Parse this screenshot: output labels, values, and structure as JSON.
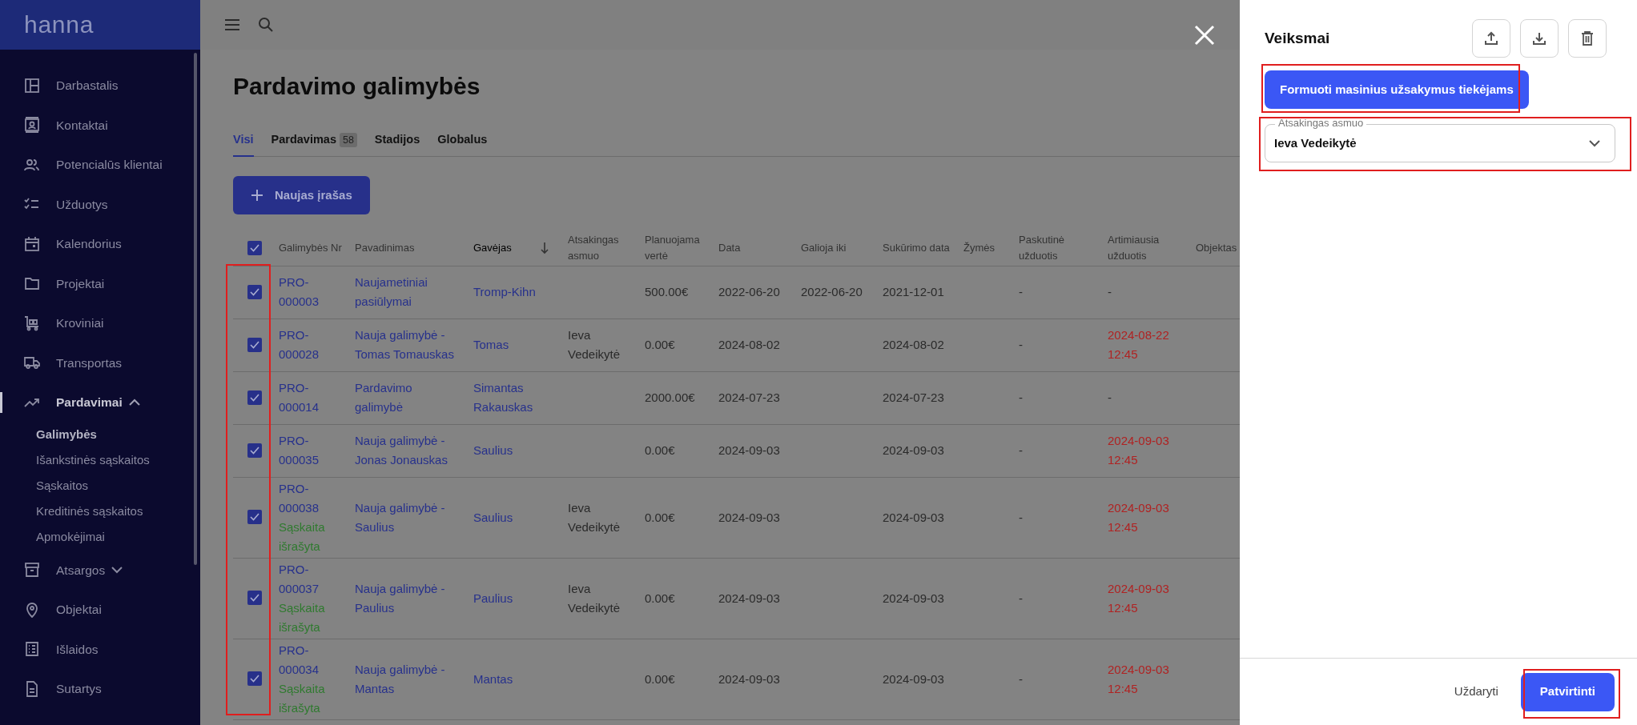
{
  "sidebar": {
    "logo": "hanna",
    "items": [
      {
        "label": "Darbastalis",
        "selected": false
      },
      {
        "label": "Kontaktai",
        "selected": false
      },
      {
        "label": "Potencialūs klientai",
        "selected": false
      },
      {
        "label": "Užduotys",
        "selected": false
      },
      {
        "label": "Kalendorius",
        "selected": false
      },
      {
        "label": "Projektai",
        "selected": false
      },
      {
        "label": "Kroviniai",
        "selected": false
      },
      {
        "label": "Transportas",
        "selected": false
      },
      {
        "label": "Pardavimai",
        "selected": true,
        "expanded": true,
        "children": [
          {
            "label": "Galimybės",
            "selected": true
          },
          {
            "label": "Išankstinės sąskaitos",
            "selected": false
          },
          {
            "label": "Sąskaitos",
            "selected": false
          },
          {
            "label": "Kreditinės sąskaitos",
            "selected": false
          },
          {
            "label": "Apmokėjimai",
            "selected": false
          }
        ]
      },
      {
        "label": "Atsargos",
        "selected": false,
        "expanded": false
      },
      {
        "label": "Objektai",
        "selected": false
      },
      {
        "label": "Išlaidos",
        "selected": false
      },
      {
        "label": "Sutartys",
        "selected": false
      }
    ]
  },
  "page": {
    "title": "Pardavimo galimybės",
    "tabs": [
      {
        "label": "Visi",
        "selected": true
      },
      {
        "label": "Pardavimas",
        "badge": "58",
        "selected": false
      },
      {
        "label": "Stadijos",
        "selected": false
      },
      {
        "label": "Globalus",
        "selected": false
      }
    ],
    "new_button": "Naujas įrašas"
  },
  "table": {
    "all_checked": true,
    "columns": [
      {
        "label": "Galimybės Nr",
        "sorted": false
      },
      {
        "label": "Pavadinimas",
        "sorted": false
      },
      {
        "label": "Gavėjas",
        "sorted": true
      },
      {
        "label": "Atsakingas asmuo",
        "sorted": false
      },
      {
        "label": "Planuojama vertė",
        "sorted": false
      },
      {
        "label": "Data",
        "sorted": false
      },
      {
        "label": "Galioja iki",
        "sorted": false
      },
      {
        "label": "Sukūrimo data",
        "sorted": false
      },
      {
        "label": "Žymės",
        "sorted": false
      },
      {
        "label": "Paskutinė užduotis",
        "sorted": false
      },
      {
        "label": "Artimiausia užduotis",
        "sorted": false
      },
      {
        "label": "Objektas",
        "sorted": false
      }
    ],
    "rows": [
      {
        "checked": true,
        "number": "PRO-000003",
        "name": "Naujametiniai pasiūlymai",
        "recipient": "Tromp-Kihn",
        "value": "500.00€",
        "date": "2022-06-20",
        "valid_until": "2022-06-20",
        "created": "2021-12-01",
        "last_task": "-",
        "next_task": "-",
        "overdue": false
      },
      {
        "checked": true,
        "number": "PRO-000028",
        "name": "Nauja galimybė - Tomas Tomauskas",
        "recipient": "Tomas",
        "responsible": "Ieva Vedeikytė",
        "value": "0.00€",
        "date": "2024-08-02",
        "created": "2024-08-02",
        "last_task": "-",
        "next_task": "2024-08-22 12:45",
        "overdue": true
      },
      {
        "checked": true,
        "number": "PRO-000014",
        "name": "Pardavimo galimybė",
        "recipient": "Simantas Rakauskas",
        "value": "2000.00€",
        "date": "2024-07-23",
        "created": "2024-07-23",
        "last_task": "-",
        "next_task": "-",
        "overdue": false
      },
      {
        "checked": true,
        "number": "PRO-000035",
        "name": "Nauja galimybė - Jonas Jonauskas",
        "recipient": "Saulius",
        "value": "0.00€",
        "date": "2024-09-03",
        "created": "2024-09-03",
        "last_task": "-",
        "next_task": "2024-09-03 12:45",
        "overdue": true
      },
      {
        "checked": true,
        "number": "PRO-000038",
        "status": "Sąskaita išrašyta",
        "name": "Nauja galimybė - Saulius",
        "recipient": "Saulius",
        "responsible": "Ieva Vedeikytė",
        "value": "0.00€",
        "date": "2024-09-03",
        "created": "2024-09-03",
        "last_task": "-",
        "next_task": "2024-09-03 12:45",
        "overdue": true
      },
      {
        "checked": true,
        "number": "PRO-000037",
        "status": "Sąskaita išrašyta",
        "name": "Nauja galimybė - Paulius",
        "recipient": "Paulius",
        "responsible": "Ieva Vedeikytė",
        "value": "0.00€",
        "date": "2024-09-03",
        "created": "2024-09-03",
        "last_task": "-",
        "next_task": "2024-09-03 12:45",
        "overdue": true
      },
      {
        "checked": true,
        "number": "PRO-000034",
        "status": "Sąskaita išrašyta",
        "name": "Nauja galimybė - Mantas",
        "recipient": "Mantas",
        "value": "0.00€",
        "date": "2024-09-03",
        "created": "2024-09-03",
        "last_task": "-",
        "next_task": "2024-09-03 12:45",
        "overdue": true
      }
    ]
  },
  "panel": {
    "title": "Veiksmai",
    "action_button": "Formuoti masinius užsakymus tiekėjams",
    "field": {
      "label": "Atsakingas asmuo",
      "value": "Ieva Vedeikytė"
    },
    "close_button": "Uždaryti",
    "confirm_button": "Patvirtinti"
  }
}
